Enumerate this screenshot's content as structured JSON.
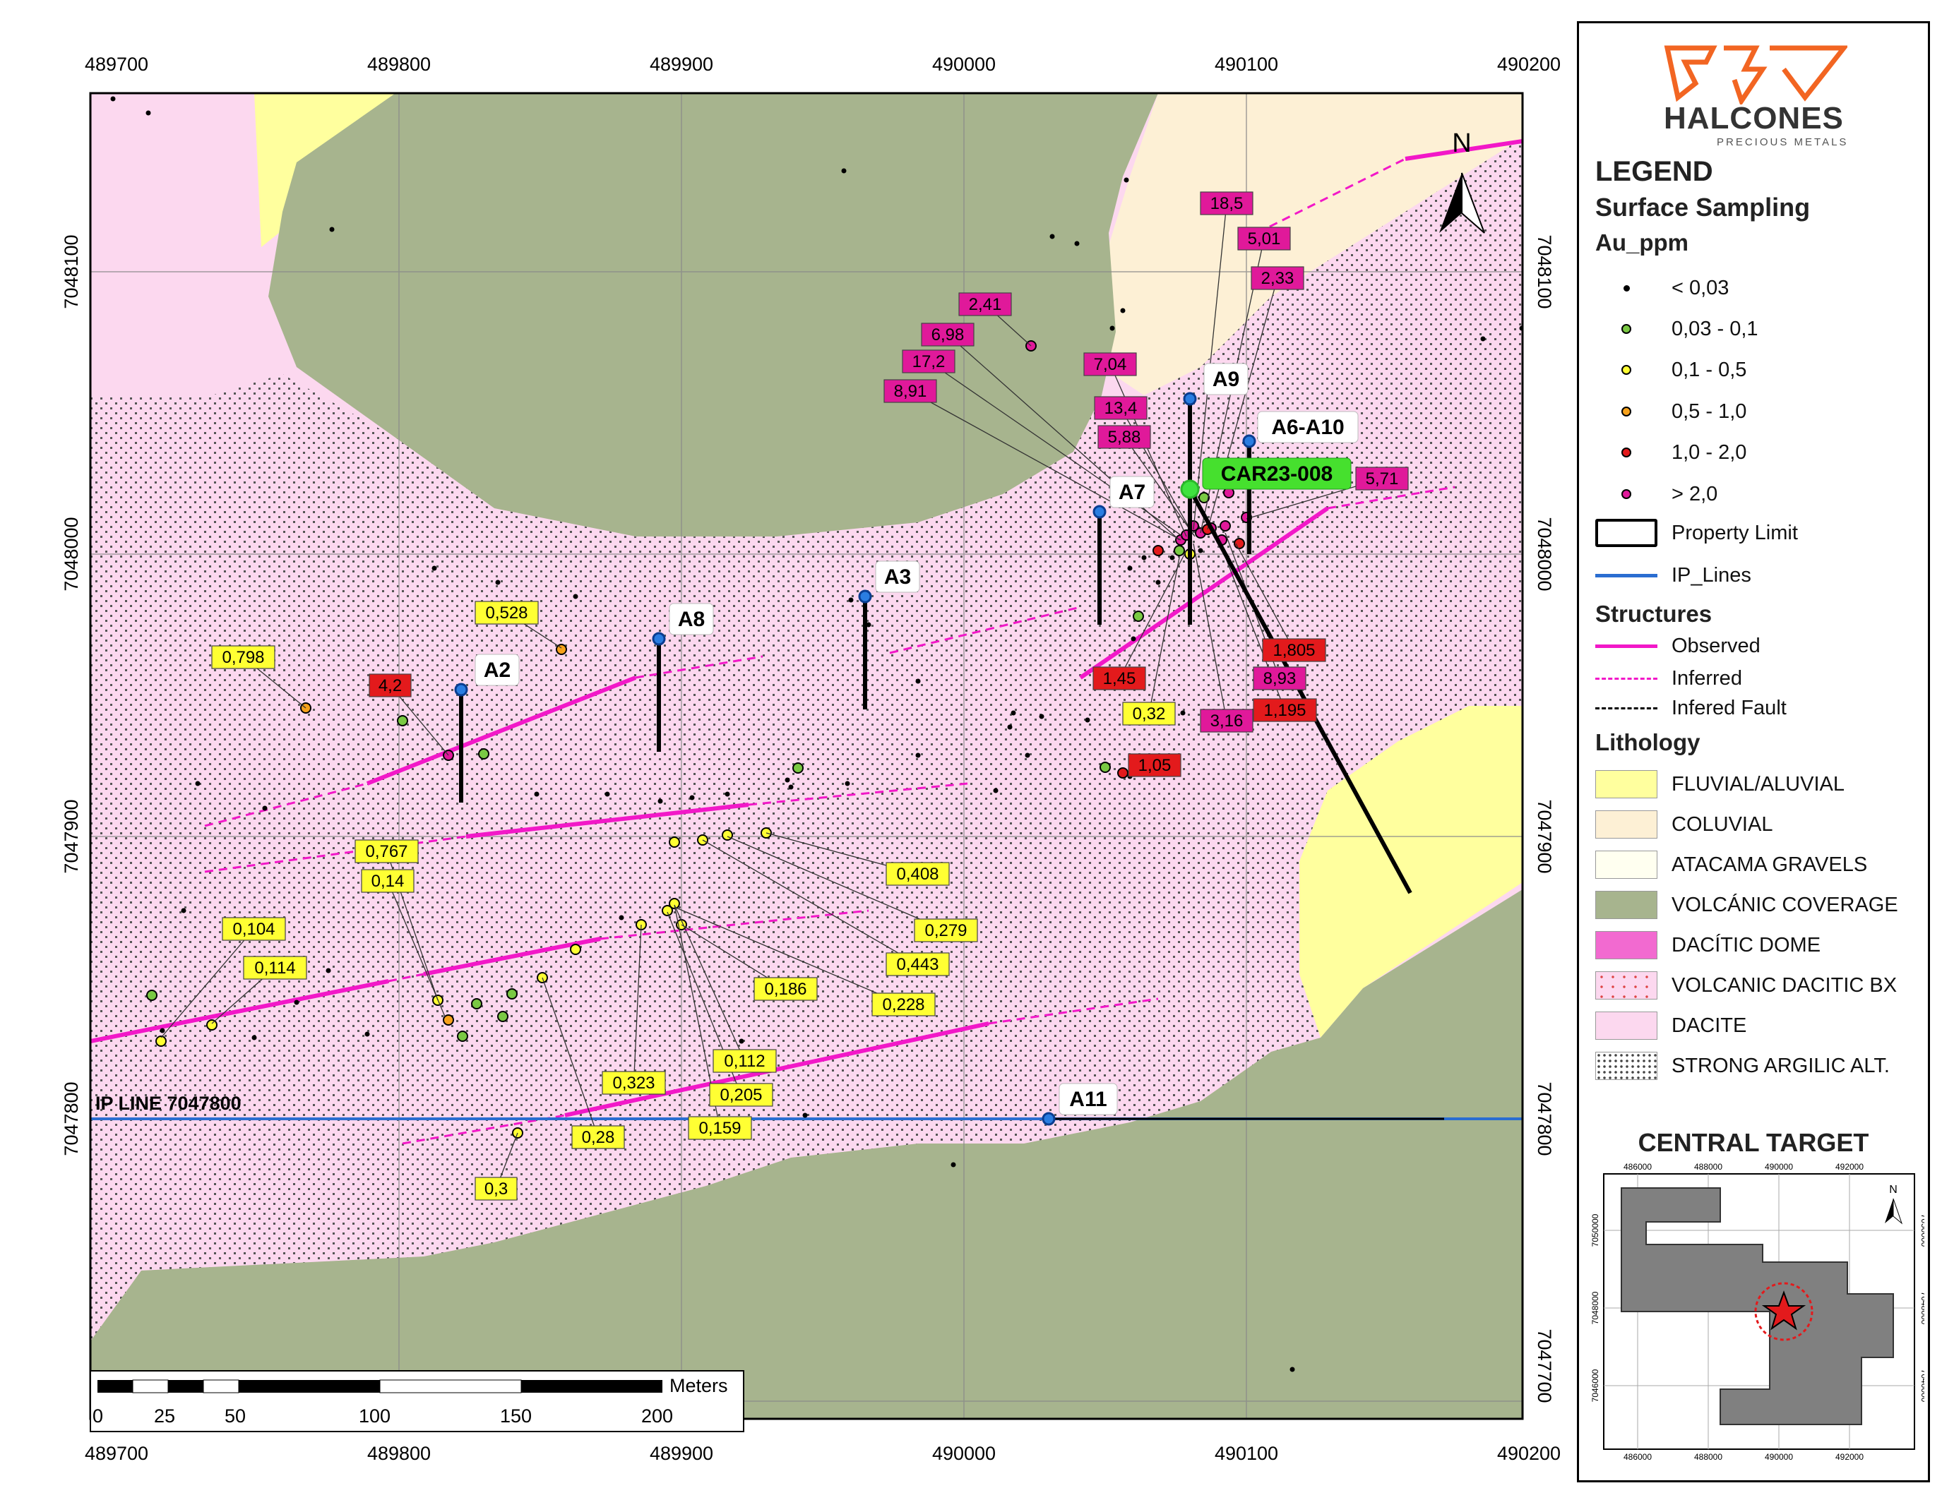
{
  "map": {
    "x_ticks": [
      "489700",
      "489800",
      "489900",
      "490000",
      "490100",
      "490200"
    ],
    "y_ticks": [
      "7048100",
      "7048000",
      "7047900",
      "7047800",
      "7047700"
    ],
    "ip_line_label": "IP LINE 7047800",
    "scale": {
      "unit": "Meters",
      "labels": [
        "0",
        "25",
        "50",
        "100",
        "150",
        "200"
      ]
    },
    "north_label": "N",
    "drillholes": [
      {
        "name": "A2",
        "top": [
          489822,
          7047952
        ],
        "bottom": [
          489822,
          7047912
        ]
      },
      {
        "name": "A8",
        "top": [
          489892,
          7047970
        ],
        "bottom": [
          489892,
          7047930
        ]
      },
      {
        "name": "A3",
        "top": [
          489965,
          7047985
        ],
        "bottom": [
          489965,
          7047945
        ]
      },
      {
        "name": "A7",
        "top": [
          490048,
          7048015
        ],
        "bottom": [
          490048,
          7047975
        ]
      },
      {
        "name": "A9",
        "top": [
          490080,
          7048055
        ],
        "bottom": [
          490080,
          7047975
        ]
      },
      {
        "name": "A6-A10",
        "top": [
          490101,
          7048040
        ],
        "bottom": [
          490101,
          7048000
        ]
      },
      {
        "name": "CAR23-008",
        "top": [
          490080,
          7048023
        ],
        "bottom": [
          490158,
          7047880
        ],
        "highlight": true
      },
      {
        "name": "A11",
        "top": [
          490030,
          7047800
        ],
        "bottom": [
          490170,
          7047800
        ]
      }
    ],
    "sample_labels": [
      {
        "text": "18,5",
        "class": "gt2"
      },
      {
        "text": "5,01",
        "class": "gt2"
      },
      {
        "text": "2,33",
        "class": "gt2"
      },
      {
        "text": "2,41",
        "class": "gt2"
      },
      {
        "text": "6,98",
        "class": "gt2"
      },
      {
        "text": "17,2",
        "class": "gt2"
      },
      {
        "text": "8,91",
        "class": "gt2"
      },
      {
        "text": "7,04",
        "class": "gt2"
      },
      {
        "text": "13,4",
        "class": "gt2"
      },
      {
        "text": "5,88",
        "class": "gt2"
      },
      {
        "text": "5,71",
        "class": "gt2"
      },
      {
        "text": "1,805",
        "class": "r12"
      },
      {
        "text": "8,93",
        "class": "gt2"
      },
      {
        "text": "1,195",
        "class": "r12"
      },
      {
        "text": "1,45",
        "class": "r12"
      },
      {
        "text": "0,32",
        "class": "low"
      },
      {
        "text": "3,16",
        "class": "gt2"
      },
      {
        "text": "1,05",
        "class": "r12"
      },
      {
        "text": "0,528",
        "class": "low"
      },
      {
        "text": "0,798",
        "class": "low"
      },
      {
        "text": "4,2",
        "class": "r12"
      },
      {
        "text": "0,767",
        "class": "low"
      },
      {
        "text": "0,14",
        "class": "low"
      },
      {
        "text": "0,104",
        "class": "low"
      },
      {
        "text": "0,114",
        "class": "low"
      },
      {
        "text": "0,408",
        "class": "low"
      },
      {
        "text": "0,279",
        "class": "low"
      },
      {
        "text": "0,443",
        "class": "low"
      },
      {
        "text": "0,186",
        "class": "low"
      },
      {
        "text": "0,228",
        "class": "low"
      },
      {
        "text": "0,112",
        "class": "low"
      },
      {
        "text": "0,323",
        "class": "low"
      },
      {
        "text": "0,205",
        "class": "low"
      },
      {
        "text": "0,159",
        "class": "low"
      },
      {
        "text": "0,28",
        "class": "low"
      },
      {
        "text": "0,3",
        "class": "low"
      }
    ]
  },
  "legend": {
    "logo_name": "HALCONES",
    "logo_sub": "PRECIOUS METALS",
    "title": "LEGEND",
    "subtitle": "Surface Sampling",
    "au_heading": "Au_ppm",
    "au_classes": [
      {
        "label": "< 0,03",
        "color": "#000000"
      },
      {
        "label": "0,03 - 0,1",
        "color": "#7ac943"
      },
      {
        "label": "0,1 - 0,5",
        "color": "#ffff33"
      },
      {
        "label": "0,5 - 1,0",
        "color": "#f7a21b"
      },
      {
        "label": "1,0 - 2,0",
        "color": "#e31a1c"
      },
      {
        "label": "> 2,0",
        "color": "#e0199a"
      }
    ],
    "property_limit": "Property Limit",
    "ip_lines": "IP_Lines",
    "structures_heading": "Structures",
    "structures": [
      "Observed",
      "Inferred",
      "Infered Fault"
    ],
    "lithology_heading": "Lithology",
    "lithology": [
      {
        "label": "FLUVIAL/ALUVIAL",
        "color": "#ffff9e"
      },
      {
        "label": "COLUVIAL",
        "color": "#fdf0d5"
      },
      {
        "label": "ATACAMA GRAVELS",
        "color": "#fffff0"
      },
      {
        "label": "VOLCÁNIC COVERAGE",
        "color": "#a7b48e"
      },
      {
        "label": "DACÍTIC DOME",
        "color": "#f26ad0"
      },
      {
        "label": "VOLCANIC DACITIC BX",
        "color": "#fcd8ef"
      },
      {
        "label": "DACITE",
        "color": "#fcd8ef"
      },
      {
        "label": "STRONG ARGILIC ALT.",
        "color": "#ffffff"
      }
    ],
    "central_target": {
      "title": "CENTRAL TARGET",
      "x_ticks": [
        "486000",
        "488000",
        "490000",
        "492000"
      ],
      "y_ticks": [
        "7050000",
        "7048000",
        "7046000"
      ],
      "north_label": "N"
    }
  }
}
